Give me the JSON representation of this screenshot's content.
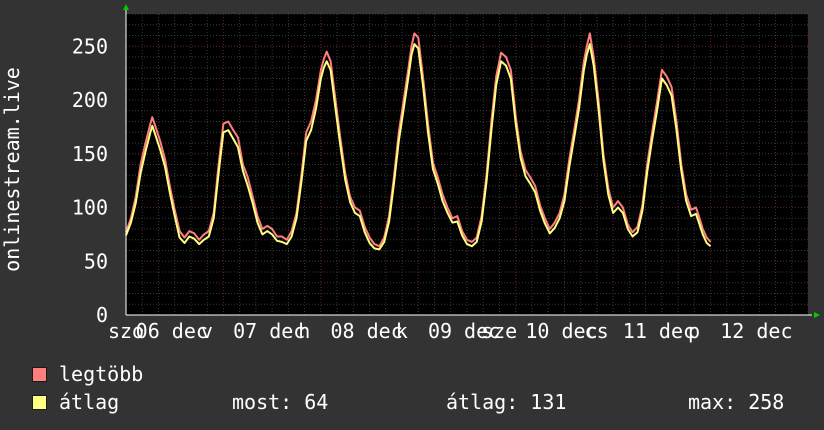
{
  "chart_data": {
    "type": "line",
    "ylabel": "onlinestream.live",
    "ylim": [
      0,
      280
    ],
    "yticks": [
      0,
      50,
      100,
      150,
      200,
      250
    ],
    "xlim": [
      0,
      7
    ],
    "xtick_labels": [
      {
        "x": 0.0,
        "label": "szo"
      },
      {
        "x": 0.47,
        "label": "06 dec"
      },
      {
        "x": 0.83,
        "label": "v"
      },
      {
        "x": 1.47,
        "label": "07 dec"
      },
      {
        "x": 1.83,
        "label": "h"
      },
      {
        "x": 2.47,
        "label": "08 dec"
      },
      {
        "x": 2.83,
        "label": "k"
      },
      {
        "x": 3.47,
        "label": "09 dec"
      },
      {
        "x": 3.83,
        "label": "sze"
      },
      {
        "x": 4.47,
        "label": "10 dec"
      },
      {
        "x": 4.83,
        "label": "cs"
      },
      {
        "x": 5.47,
        "label": "11 dec"
      },
      {
        "x": 5.83,
        "label": "p"
      },
      {
        "x": 6.47,
        "label": "12 dec"
      }
    ],
    "grid": true,
    "series": [
      {
        "name": "legtöbb",
        "color": "#ff7f7f",
        "points": [
          [
            0.0,
            77
          ],
          [
            0.05,
            90
          ],
          [
            0.1,
            110
          ],
          [
            0.15,
            140
          ],
          [
            0.2,
            160
          ],
          [
            0.25,
            178
          ],
          [
            0.27,
            184
          ],
          [
            0.3,
            176
          ],
          [
            0.35,
            162
          ],
          [
            0.4,
            145
          ],
          [
            0.45,
            120
          ],
          [
            0.5,
            98
          ],
          [
            0.55,
            78
          ],
          [
            0.6,
            72
          ],
          [
            0.65,
            78
          ],
          [
            0.7,
            76
          ],
          [
            0.75,
            70
          ],
          [
            0.8,
            75
          ],
          [
            0.85,
            78
          ],
          [
            0.9,
            95
          ],
          [
            0.95,
            140
          ],
          [
            1.0,
            178
          ],
          [
            1.05,
            180
          ],
          [
            1.1,
            172
          ],
          [
            1.15,
            165
          ],
          [
            1.2,
            140
          ],
          [
            1.25,
            128
          ],
          [
            1.3,
            110
          ],
          [
            1.35,
            92
          ],
          [
            1.4,
            80
          ],
          [
            1.45,
            83
          ],
          [
            1.5,
            80
          ],
          [
            1.55,
            73
          ],
          [
            1.6,
            73
          ],
          [
            1.65,
            70
          ],
          [
            1.7,
            78
          ],
          [
            1.75,
            95
          ],
          [
            1.8,
            130
          ],
          [
            1.85,
            170
          ],
          [
            1.9,
            180
          ],
          [
            1.95,
            200
          ],
          [
            2.0,
            228
          ],
          [
            2.03,
            238
          ],
          [
            2.06,
            245
          ],
          [
            2.1,
            236
          ],
          [
            2.15,
            200
          ],
          [
            2.2,
            165
          ],
          [
            2.25,
            132
          ],
          [
            2.3,
            110
          ],
          [
            2.35,
            100
          ],
          [
            2.4,
            97
          ],
          [
            2.45,
            82
          ],
          [
            2.5,
            72
          ],
          [
            2.55,
            66
          ],
          [
            2.6,
            64
          ],
          [
            2.65,
            72
          ],
          [
            2.7,
            92
          ],
          [
            2.75,
            128
          ],
          [
            2.8,
            170
          ],
          [
            2.85,
            200
          ],
          [
            2.9,
            230
          ],
          [
            2.93,
            250
          ],
          [
            2.96,
            262
          ],
          [
            3.0,
            258
          ],
          [
            3.05,
            220
          ],
          [
            3.1,
            178
          ],
          [
            3.15,
            142
          ],
          [
            3.2,
            128
          ],
          [
            3.25,
            112
          ],
          [
            3.3,
            100
          ],
          [
            3.35,
            90
          ],
          [
            3.4,
            92
          ],
          [
            3.45,
            78
          ],
          [
            3.5,
            70
          ],
          [
            3.55,
            68
          ],
          [
            3.6,
            72
          ],
          [
            3.65,
            92
          ],
          [
            3.7,
            130
          ],
          [
            3.75,
            180
          ],
          [
            3.8,
            222
          ],
          [
            3.85,
            244
          ],
          [
            3.9,
            240
          ],
          [
            3.95,
            228
          ],
          [
            4.0,
            185
          ],
          [
            4.05,
            152
          ],
          [
            4.1,
            135
          ],
          [
            4.15,
            128
          ],
          [
            4.2,
            120
          ],
          [
            4.25,
            102
          ],
          [
            4.3,
            90
          ],
          [
            4.35,
            80
          ],
          [
            4.4,
            86
          ],
          [
            4.45,
            95
          ],
          [
            4.5,
            112
          ],
          [
            4.55,
            145
          ],
          [
            4.6,
            172
          ],
          [
            4.65,
            200
          ],
          [
            4.7,
            236
          ],
          [
            4.73,
            250
          ],
          [
            4.76,
            262
          ],
          [
            4.8,
            240
          ],
          [
            4.85,
            200
          ],
          [
            4.9,
            150
          ],
          [
            4.95,
            118
          ],
          [
            5.0,
            100
          ],
          [
            5.05,
            106
          ],
          [
            5.1,
            100
          ],
          [
            5.15,
            84
          ],
          [
            5.2,
            77
          ],
          [
            5.25,
            82
          ],
          [
            5.3,
            102
          ],
          [
            5.35,
            140
          ],
          [
            5.4,
            170
          ],
          [
            5.45,
            198
          ],
          [
            5.5,
            228
          ],
          [
            5.55,
            222
          ],
          [
            5.6,
            212
          ],
          [
            5.65,
            180
          ],
          [
            5.7,
            140
          ],
          [
            5.75,
            112
          ],
          [
            5.8,
            98
          ],
          [
            5.85,
            100
          ],
          [
            5.88,
            92
          ],
          [
            5.92,
            80
          ],
          [
            5.96,
            72
          ],
          [
            6.0,
            68
          ]
        ]
      },
      {
        "name": "átlag",
        "color": "#ffff80",
        "points": [
          [
            0.0,
            74
          ],
          [
            0.05,
            86
          ],
          [
            0.1,
            104
          ],
          [
            0.15,
            132
          ],
          [
            0.2,
            152
          ],
          [
            0.25,
            170
          ],
          [
            0.27,
            176
          ],
          [
            0.3,
            168
          ],
          [
            0.35,
            154
          ],
          [
            0.4,
            138
          ],
          [
            0.45,
            114
          ],
          [
            0.5,
            92
          ],
          [
            0.55,
            72
          ],
          [
            0.6,
            67
          ],
          [
            0.65,
            73
          ],
          [
            0.7,
            71
          ],
          [
            0.75,
            66
          ],
          [
            0.8,
            70
          ],
          [
            0.85,
            73
          ],
          [
            0.9,
            90
          ],
          [
            0.95,
            132
          ],
          [
            1.0,
            170
          ],
          [
            1.05,
            172
          ],
          [
            1.1,
            164
          ],
          [
            1.15,
            156
          ],
          [
            1.2,
            134
          ],
          [
            1.25,
            120
          ],
          [
            1.3,
            104
          ],
          [
            1.35,
            86
          ],
          [
            1.4,
            75
          ],
          [
            1.45,
            78
          ],
          [
            1.5,
            75
          ],
          [
            1.55,
            69
          ],
          [
            1.6,
            68
          ],
          [
            1.65,
            66
          ],
          [
            1.7,
            73
          ],
          [
            1.75,
            90
          ],
          [
            1.8,
            124
          ],
          [
            1.85,
            162
          ],
          [
            1.9,
            172
          ],
          [
            1.95,
            192
          ],
          [
            2.0,
            220
          ],
          [
            2.03,
            230
          ],
          [
            2.06,
            236
          ],
          [
            2.1,
            228
          ],
          [
            2.15,
            192
          ],
          [
            2.2,
            158
          ],
          [
            2.25,
            126
          ],
          [
            2.3,
            105
          ],
          [
            2.35,
            95
          ],
          [
            2.4,
            92
          ],
          [
            2.45,
            77
          ],
          [
            2.5,
            67
          ],
          [
            2.55,
            62
          ],
          [
            2.6,
            61
          ],
          [
            2.65,
            68
          ],
          [
            2.7,
            87
          ],
          [
            2.75,
            122
          ],
          [
            2.8,
            162
          ],
          [
            2.85,
            192
          ],
          [
            2.9,
            222
          ],
          [
            2.93,
            242
          ],
          [
            2.96,
            252
          ],
          [
            3.0,
            248
          ],
          [
            3.05,
            212
          ],
          [
            3.1,
            170
          ],
          [
            3.15,
            136
          ],
          [
            3.2,
            122
          ],
          [
            3.25,
            106
          ],
          [
            3.3,
            95
          ],
          [
            3.35,
            86
          ],
          [
            3.4,
            87
          ],
          [
            3.45,
            74
          ],
          [
            3.5,
            66
          ],
          [
            3.55,
            64
          ],
          [
            3.6,
            68
          ],
          [
            3.65,
            87
          ],
          [
            3.7,
            124
          ],
          [
            3.75,
            172
          ],
          [
            3.8,
            214
          ],
          [
            3.85,
            236
          ],
          [
            3.9,
            232
          ],
          [
            3.95,
            220
          ],
          [
            4.0,
            178
          ],
          [
            4.05,
            146
          ],
          [
            4.1,
            129
          ],
          [
            4.15,
            122
          ],
          [
            4.2,
            114
          ],
          [
            4.25,
            97
          ],
          [
            4.3,
            85
          ],
          [
            4.35,
            76
          ],
          [
            4.4,
            81
          ],
          [
            4.45,
            90
          ],
          [
            4.5,
            106
          ],
          [
            4.55,
            138
          ],
          [
            4.6,
            165
          ],
          [
            4.65,
            192
          ],
          [
            4.7,
            228
          ],
          [
            4.73,
            242
          ],
          [
            4.76,
            252
          ],
          [
            4.8,
            232
          ],
          [
            4.85,
            192
          ],
          [
            4.9,
            144
          ],
          [
            4.95,
            112
          ],
          [
            5.0,
            95
          ],
          [
            5.05,
            100
          ],
          [
            5.1,
            95
          ],
          [
            5.15,
            80
          ],
          [
            5.2,
            73
          ],
          [
            5.25,
            77
          ],
          [
            5.3,
            97
          ],
          [
            5.35,
            133
          ],
          [
            5.4,
            163
          ],
          [
            5.45,
            190
          ],
          [
            5.5,
            220
          ],
          [
            5.55,
            214
          ],
          [
            5.6,
            204
          ],
          [
            5.65,
            172
          ],
          [
            5.7,
            134
          ],
          [
            5.75,
            106
          ],
          [
            5.8,
            92
          ],
          [
            5.85,
            94
          ],
          [
            5.88,
            86
          ],
          [
            5.92,
            75
          ],
          [
            5.96,
            67
          ],
          [
            6.0,
            64
          ]
        ]
      }
    ]
  },
  "legend": [
    {
      "label": "legtöbb",
      "color": "#ff7f7f"
    },
    {
      "label": "átlag",
      "color": "#ffff80"
    }
  ],
  "stats": {
    "current": "most: 64",
    "average": "átlag: 131",
    "max": "max: 258"
  },
  "colors": {
    "background": "#333333",
    "plot_background": "#000000",
    "grid_minor": "#3a3a3a",
    "grid_major": "#5a1e1e",
    "axis": "#ffffff",
    "arrow": "#00cc00",
    "text": "#ffffff"
  }
}
